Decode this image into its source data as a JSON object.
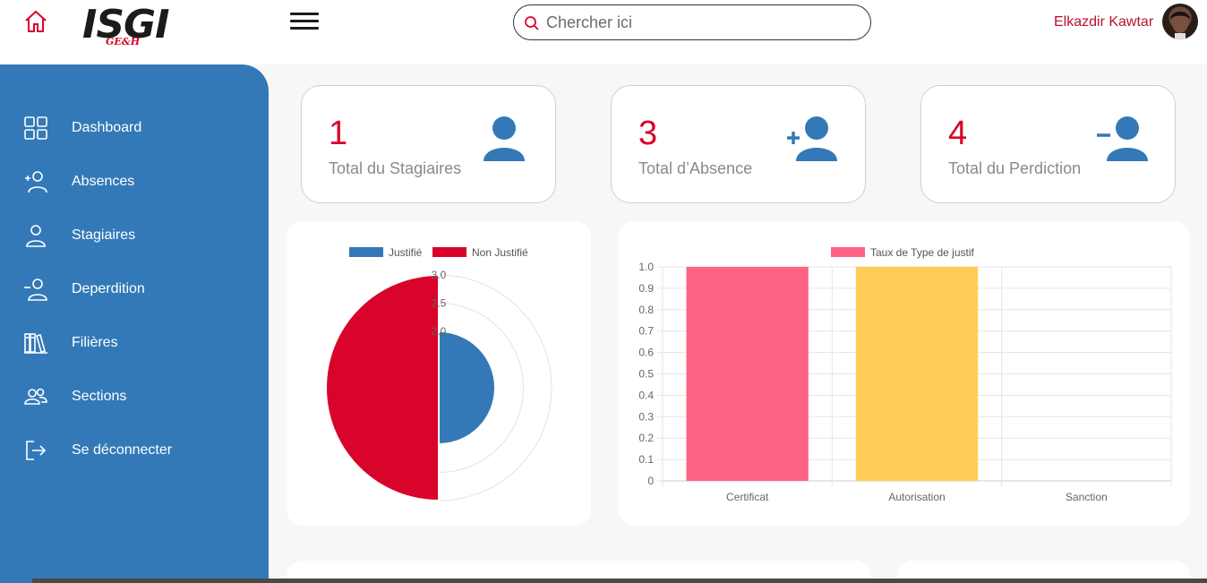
{
  "header": {
    "logo_text": "ISGI",
    "logo_sub": "GE&H",
    "search_placeholder": "Chercher ici",
    "user_name": "Elkazdir Kawtar"
  },
  "sidebar": {
    "items": [
      {
        "label": "Dashboard",
        "icon": "grid-icon"
      },
      {
        "label": "Absences",
        "icon": "user-plus-icon"
      },
      {
        "label": "Stagiaires",
        "icon": "user-icon"
      },
      {
        "label": "Deperdition",
        "icon": "user-minus-icon"
      },
      {
        "label": "Filières",
        "icon": "books-icon"
      },
      {
        "label": "Sections",
        "icon": "users-icon"
      },
      {
        "label": "Se déconnecter",
        "icon": "logout-icon"
      }
    ]
  },
  "cards": [
    {
      "value": "1",
      "caption": "Total du Stagiaires",
      "icon": "user-icon"
    },
    {
      "value": "3",
      "caption": "Total d’Absence",
      "icon": "user-plus-icon"
    },
    {
      "value": "4",
      "caption": "Total du Perdiction",
      "icon": "user-minus-icon"
    }
  ],
  "colors": {
    "accent_red": "#d9042b",
    "sidebar_blue": "#3379b7",
    "bar_pink": "#ff6384",
    "bar_yellow": "#ffcd56"
  },
  "chart_data": [
    {
      "type": "polarArea",
      "legend": [
        "Justifié",
        "Non Justifié"
      ],
      "values": [
        2,
        3
      ],
      "colors": [
        "#3379b7",
        "#d9042b"
      ],
      "r_ticks": [
        "2.0",
        "2.5",
        "3.0"
      ],
      "r_range": [
        1.0,
        3.0
      ],
      "legend_position": "top"
    },
    {
      "type": "bar",
      "series": [
        {
          "name": "Taux de Type de justif",
          "values": [
            1,
            1,
            0
          ]
        }
      ],
      "categories": [
        "Certificat",
        "Autorisation",
        "Sanction"
      ],
      "colors": [
        "#ff6384",
        "#ffcd56",
        "#4bc0c0"
      ],
      "ylim": [
        0,
        1
      ],
      "y_ticks": [
        "0",
        "0.1",
        "0.2",
        "0.3",
        "0.4",
        "0.5",
        "0.6",
        "0.7",
        "0.8",
        "0.9",
        "1.0"
      ],
      "grid": true,
      "legend_position": "top"
    }
  ]
}
